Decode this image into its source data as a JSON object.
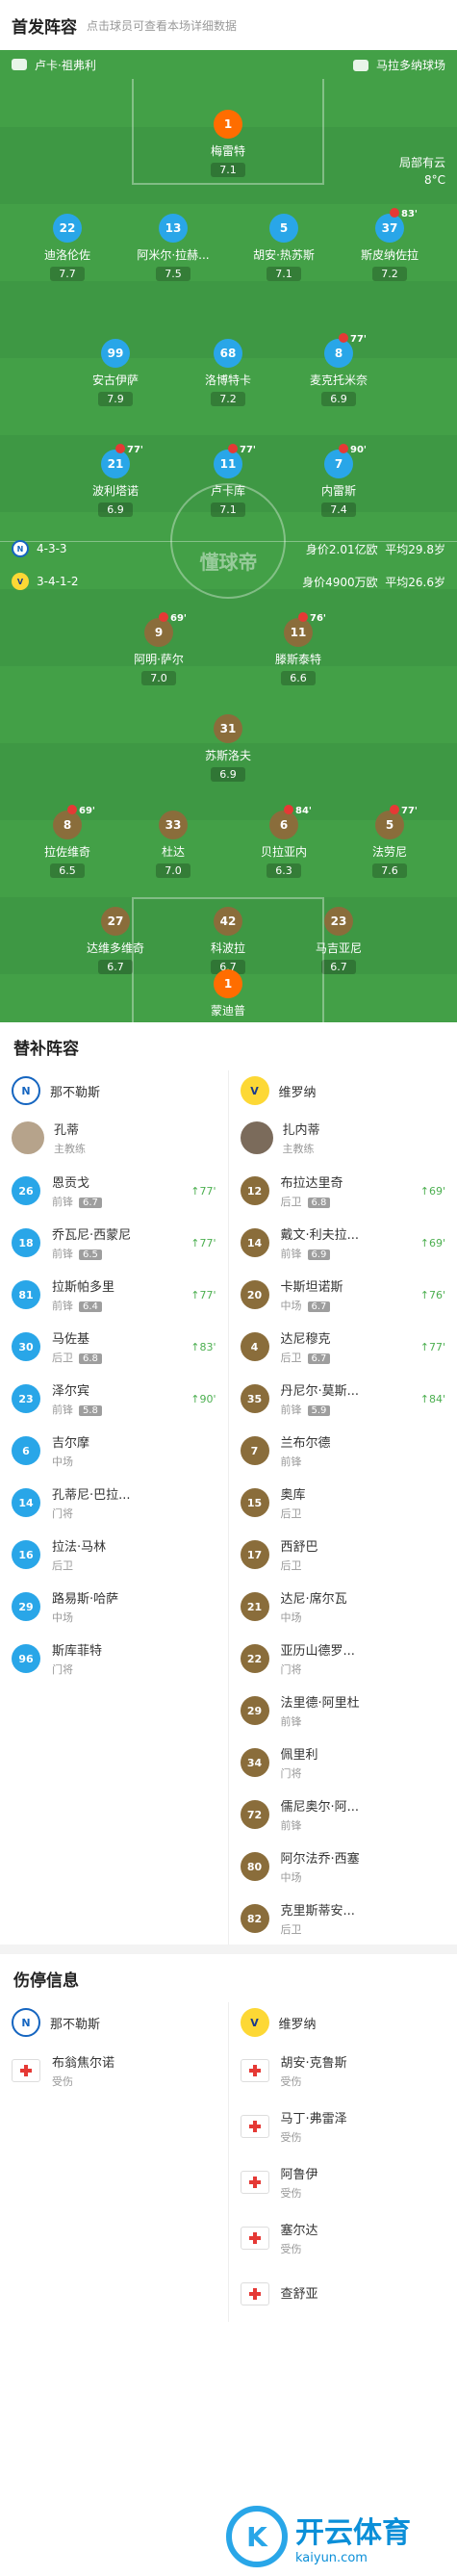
{
  "header": {
    "title": "首发阵容",
    "subtitle": "点击球员可查看本场详细数据"
  },
  "match": {
    "home_coach": "卢卡·祖弗利",
    "stadium": "马拉多纳球场",
    "weather": "局部有云",
    "temp": "8°C"
  },
  "napoli_form": {
    "formation": "4-3-3",
    "value": "身价2.01亿欧",
    "age": "平均29.8岁"
  },
  "verona_form": {
    "formation": "3-4-1-2",
    "value": "身价4900万欧",
    "age": "平均26.6岁"
  },
  "watermark": "懂球帝",
  "napoli_players": [
    {
      "num": "1",
      "name": "梅雷特",
      "rating": "7.1"
    },
    {
      "num": "22",
      "name": "迪洛伦佐",
      "rating": "7.7"
    },
    {
      "num": "13",
      "name": "阿米尔·拉赫...",
      "rating": "7.5"
    },
    {
      "num": "5",
      "name": "胡安·热苏斯",
      "rating": "7.1"
    },
    {
      "num": "37",
      "name": "斯皮纳佐拉",
      "rating": "7.2",
      "sub": "83'"
    },
    {
      "num": "99",
      "name": "安古伊萨",
      "rating": "7.9"
    },
    {
      "num": "68",
      "name": "洛博特卡",
      "rating": "7.2"
    },
    {
      "num": "8",
      "name": "麦克托米奈",
      "rating": "6.9",
      "sub": "77'"
    },
    {
      "num": "21",
      "name": "波利塔诺",
      "rating": "6.9",
      "sub": "77'"
    },
    {
      "num": "11",
      "name": "卢卡库",
      "rating": "7.1",
      "sub": "77'"
    },
    {
      "num": "7",
      "name": "内雷斯",
      "rating": "7.4",
      "sub": "90'"
    }
  ],
  "verona_players": [
    {
      "num": "9",
      "name": "阿明·萨尔",
      "rating": "7.0",
      "sub": "69'"
    },
    {
      "num": "11",
      "name": "滕斯泰特",
      "rating": "6.6",
      "sub": "76'"
    },
    {
      "num": "31",
      "name": "苏斯洛夫",
      "rating": "6.9"
    },
    {
      "num": "8",
      "name": "拉佐维奇",
      "rating": "6.5",
      "sub": "69'"
    },
    {
      "num": "33",
      "name": "杜达",
      "rating": "7.0"
    },
    {
      "num": "6",
      "name": "贝拉亚内",
      "rating": "6.3",
      "sub": "84'"
    },
    {
      "num": "5",
      "name": "法劳尼",
      "rating": "7.6",
      "sub": "77'"
    },
    {
      "num": "27",
      "name": "达维多维奇",
      "rating": "6.7"
    },
    {
      "num": "42",
      "name": "科波拉",
      "rating": "6.7"
    },
    {
      "num": "23",
      "name": "马吉亚尼",
      "rating": "6.7"
    },
    {
      "num": "1",
      "name": "蒙迪普",
      "rating": "6.1"
    }
  ],
  "subs": {
    "title": "替补阵容",
    "home": {
      "team": "那不勒斯",
      "coach": "孔蒂",
      "coach_role": "主教练",
      "players": [
        {
          "num": "26",
          "name": "恩贡戈",
          "pos": "前锋",
          "score": "6.7",
          "min": "77'"
        },
        {
          "num": "18",
          "name": "乔瓦尼·西蒙尼",
          "pos": "前锋",
          "score": "6.5",
          "min": "77'"
        },
        {
          "num": "81",
          "name": "拉斯帕多里",
          "pos": "前锋",
          "score": "6.4",
          "min": "77'"
        },
        {
          "num": "30",
          "name": "马佐基",
          "pos": "后卫",
          "score": "6.8",
          "min": "83'"
        },
        {
          "num": "23",
          "name": "泽尔宾",
          "pos": "前锋",
          "score": "5.8",
          "min": "90'"
        },
        {
          "num": "6",
          "name": "吉尔摩",
          "pos": "中场"
        },
        {
          "num": "14",
          "name": "孔蒂尼·巴拉...",
          "pos": "门将"
        },
        {
          "num": "16",
          "name": "拉法·马林",
          "pos": "后卫"
        },
        {
          "num": "29",
          "name": "路易斯·哈萨",
          "pos": "中场"
        },
        {
          "num": "96",
          "name": "斯库菲特",
          "pos": "门将"
        }
      ]
    },
    "away": {
      "team": "维罗纳",
      "coach": "扎内蒂",
      "coach_role": "主教练",
      "players": [
        {
          "num": "12",
          "name": "布拉达里奇",
          "pos": "后卫",
          "score": "6.8",
          "min": "69'"
        },
        {
          "num": "14",
          "name": "戴文·利夫拉...",
          "pos": "前锋",
          "score": "6.9",
          "min": "69'"
        },
        {
          "num": "20",
          "name": "卡斯坦诺斯",
          "pos": "中场",
          "score": "6.7",
          "min": "76'"
        },
        {
          "num": "4",
          "name": "达尼穆克",
          "pos": "后卫",
          "score": "6.7",
          "min": "77'"
        },
        {
          "num": "35",
          "name": "丹尼尔·莫斯...",
          "pos": "前锋",
          "score": "5.9",
          "min": "84'"
        },
        {
          "num": "7",
          "name": "兰布尔德",
          "pos": "前锋"
        },
        {
          "num": "15",
          "name": "奥库",
          "pos": "后卫"
        },
        {
          "num": "17",
          "name": "西舒巴",
          "pos": "后卫"
        },
        {
          "num": "21",
          "name": "达尼·席尔瓦",
          "pos": "中场"
        },
        {
          "num": "22",
          "name": "亚历山德罗...",
          "pos": "门将"
        },
        {
          "num": "29",
          "name": "法里德·阿里杜",
          "pos": "前锋"
        },
        {
          "num": "34",
          "name": "佩里利",
          "pos": "门将"
        },
        {
          "num": "72",
          "name": "儒尼奥尔·阿...",
          "pos": "前锋"
        },
        {
          "num": "80",
          "name": "阿尔法乔·西塞",
          "pos": "中场"
        },
        {
          "num": "82",
          "name": "克里斯蒂安...",
          "pos": "后卫"
        }
      ]
    }
  },
  "injuries": {
    "title": "伤停信息",
    "home": {
      "team": "那不勒斯",
      "players": [
        {
          "name": "布翁焦尔诺",
          "status": "受伤"
        }
      ]
    },
    "away": {
      "team": "维罗纳",
      "players": [
        {
          "name": "胡安·克鲁斯",
          "status": "受伤"
        },
        {
          "name": "马丁·弗雷泽",
          "status": "受伤"
        },
        {
          "name": "阿鲁伊",
          "status": "受伤"
        },
        {
          "name": "塞尔达",
          "status": "受伤"
        },
        {
          "name": "查舒亚",
          "status": ""
        }
      ]
    }
  },
  "brand": {
    "cn": "开云体育",
    "en": "kaiyun.com",
    "mark": "K"
  }
}
